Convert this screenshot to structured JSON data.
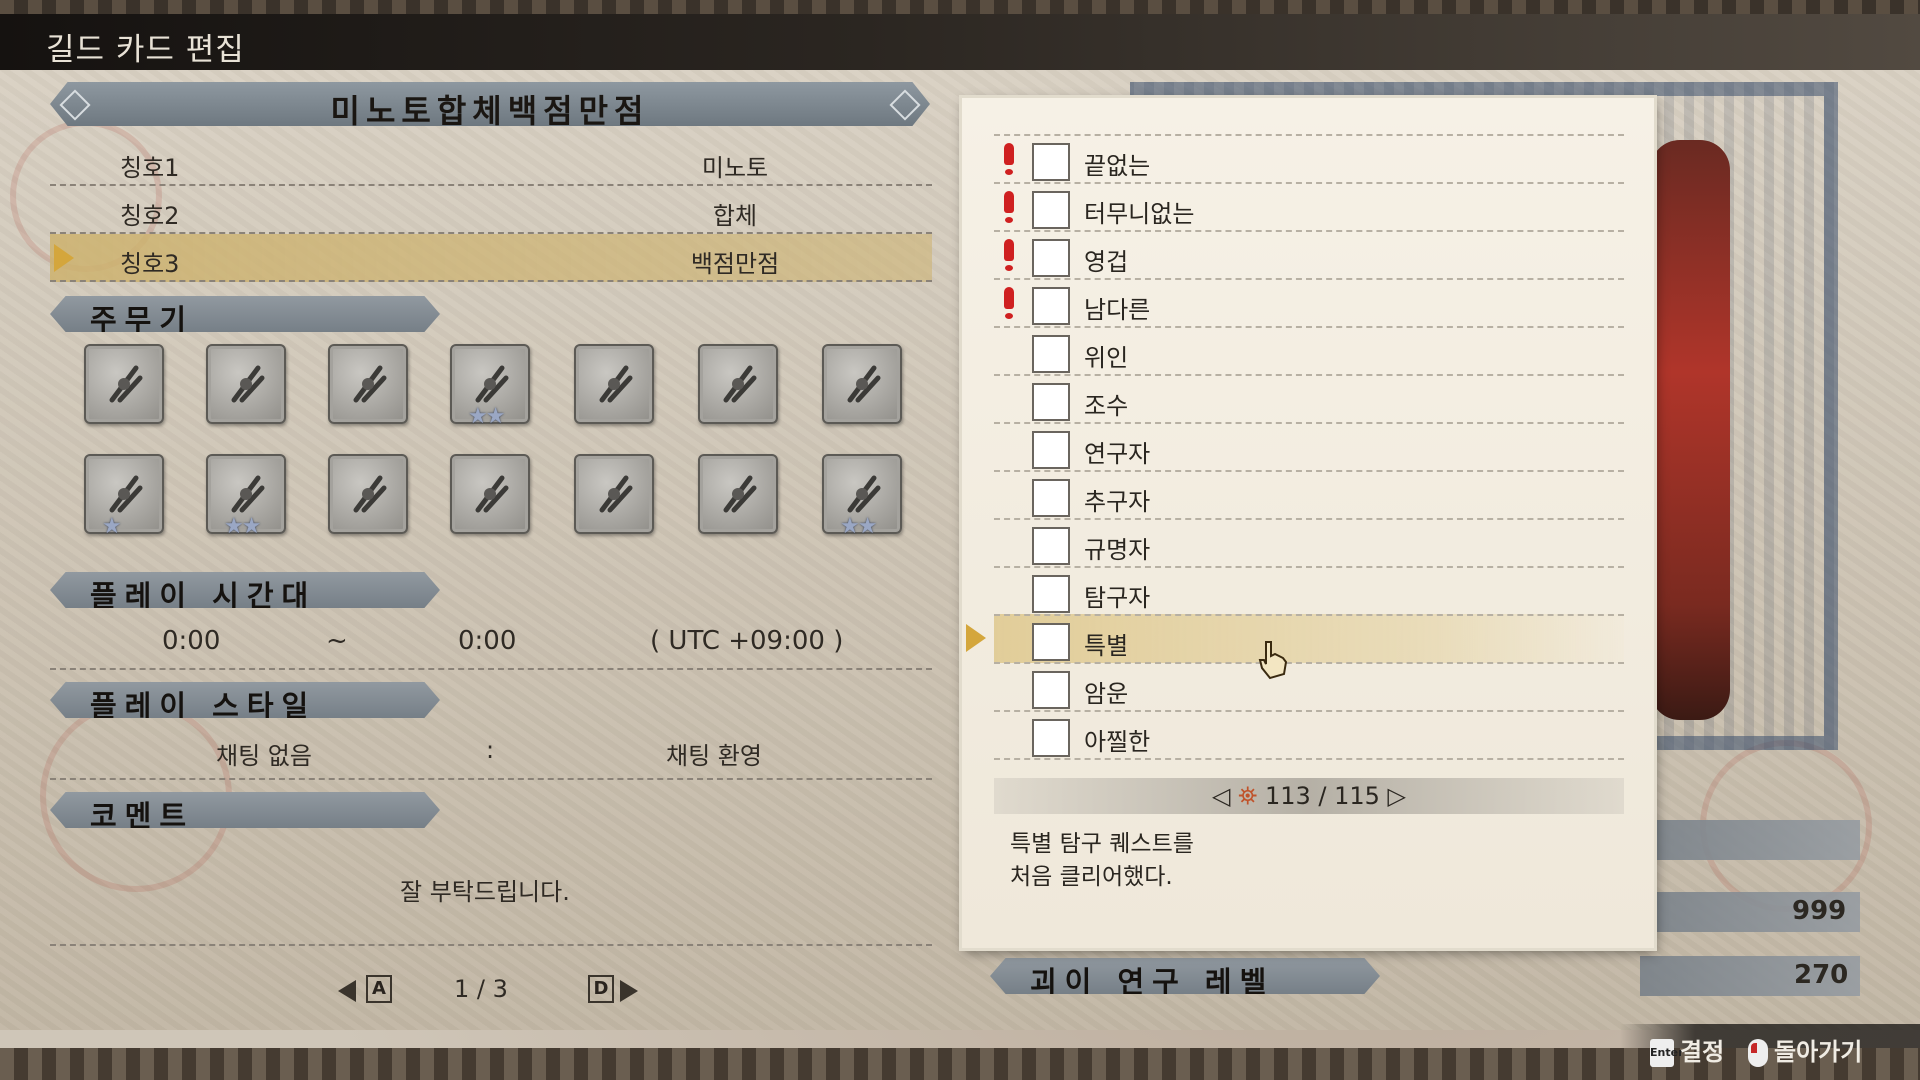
{
  "screen_title": "길드 카드 편집",
  "guild_name": "미노토합체백점만점",
  "titles": [
    {
      "label": "칭호1",
      "value": "미노토"
    },
    {
      "label": "칭호2",
      "value": "합체"
    },
    {
      "label": "칭호3",
      "value": "백점만점"
    }
  ],
  "sections": {
    "weapon": "주무기",
    "playtime": "플레이 시간대",
    "playstyle": "플레이 스타일",
    "comment": "코멘트",
    "research": "괴이 연구 레벨"
  },
  "weapons_row1": [
    {
      "icon": "great-sword-icon",
      "stars": ""
    },
    {
      "icon": "long-sword-icon",
      "stars": ""
    },
    {
      "icon": "sword-shield-icon",
      "stars": ""
    },
    {
      "icon": "dual-blades-icon",
      "stars": "★★"
    },
    {
      "icon": "hammer-icon",
      "stars": ""
    },
    {
      "icon": "hunting-horn-icon",
      "stars": ""
    },
    {
      "icon": "lance-icon",
      "stars": ""
    }
  ],
  "weapons_row2": [
    {
      "icon": "gunlance-icon",
      "stars": "★"
    },
    {
      "icon": "switch-axe-icon",
      "stars": "★★"
    },
    {
      "icon": "charge-blade-icon",
      "stars": ""
    },
    {
      "icon": "insect-glaive-icon",
      "stars": ""
    },
    {
      "icon": "light-bowgun-icon",
      "stars": ""
    },
    {
      "icon": "heavy-bowgun-icon",
      "stars": ""
    },
    {
      "icon": "bow-icon",
      "stars": "★★"
    }
  ],
  "playtime": {
    "start": "0:00",
    "separator": "~",
    "end": "0:00",
    "timezone": "( UTC  +09:00 )"
  },
  "playstyle": {
    "left": "채팅 없음",
    "separator": ":",
    "right": "채팅 환영"
  },
  "comment": "잘 부탁드립니다.",
  "left_pager": {
    "key_prev": "A",
    "page": "1  /  3",
    "key_next": "D"
  },
  "list_items": [
    {
      "label": "끝없는",
      "new": true
    },
    {
      "label": "터무니없는",
      "new": true
    },
    {
      "label": "영겁",
      "new": true
    },
    {
      "label": "남다른",
      "new": true
    },
    {
      "label": "위인",
      "new": false
    },
    {
      "label": "조수",
      "new": false
    },
    {
      "label": "연구자",
      "new": false
    },
    {
      "label": "추구자",
      "new": false
    },
    {
      "label": "규명자",
      "new": false
    },
    {
      "label": "탐구자",
      "new": false
    },
    {
      "label": "특별",
      "new": false
    },
    {
      "label": "암운",
      "new": false
    },
    {
      "label": "아찔한",
      "new": false
    }
  ],
  "selected_index": 10,
  "list_pager": "113 / 115",
  "description_line1": "특별 탐구 퀘스트를",
  "description_line2": "처음 클리어했다.",
  "stats": {
    "value1": "999",
    "value2": "270"
  },
  "footer": {
    "confirm_key": "Enter",
    "confirm_label": "결정",
    "back_label": "돌아가기"
  },
  "colors": {
    "accent_gold": "#d4a63c",
    "new_mark": "#cf2020",
    "banner": "#7e878f"
  }
}
